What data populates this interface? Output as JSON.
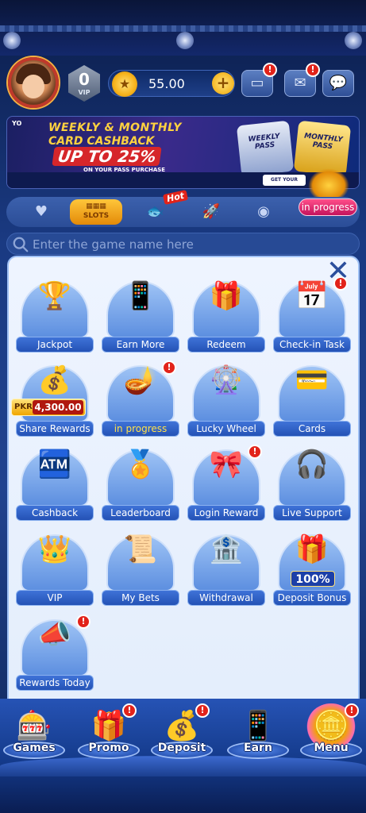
{
  "header": {
    "vip_level": "0",
    "vip_label": "VIP",
    "currency_symbol": "★",
    "balance": "55.00",
    "add_label": "+",
    "wallet_badge": "!",
    "mail_badge": "!"
  },
  "banner": {
    "logo": "YO",
    "line1": "WEEKLY & MONTHLY",
    "line2": "CARD CASHBACK",
    "line3": "UP TO 25%",
    "line4": "ON YOUR PASS PURCHASE",
    "pass1": "WEEKLY PASS",
    "pass2": "MONTHLY PASS",
    "cta": "GET YOUR CLAIM YOUR"
  },
  "categories": {
    "active_label": "SLOTS",
    "hot_label": "Hot",
    "in_progress": "in progress"
  },
  "search": {
    "placeholder": "Enter the game name here"
  },
  "panel": {
    "close_label": "✕",
    "tiles": [
      {
        "label": "Jackpot",
        "icon": "trophy-icon",
        "glyph": "🏆",
        "badge": ""
      },
      {
        "label": "Earn More",
        "icon": "phone-money-icon",
        "glyph": "📱",
        "badge": ""
      },
      {
        "label": "Redeem",
        "icon": "code-bag-icon",
        "glyph": "🎁",
        "badge": ""
      },
      {
        "label": "Check-in Task",
        "icon": "calendar-check-icon",
        "glyph": "📅",
        "badge": "!"
      },
      {
        "label": "Share Rewards",
        "icon": "treasure-chest-icon",
        "glyph": "💰",
        "badge": "",
        "pkr_currency": "PKR",
        "pkr_amount": "4,300.00"
      },
      {
        "label": "in progress",
        "icon": "magic-lamp-icon",
        "glyph": "🪔",
        "badge": "!"
      },
      {
        "label": "Lucky Wheel",
        "icon": "wheel-icon",
        "glyph": "🎡",
        "badge": ""
      },
      {
        "label": "Cards",
        "icon": "card-icon",
        "glyph": "💳",
        "badge": ""
      },
      {
        "label": "Cashback",
        "icon": "cashback-machine-icon",
        "glyph": "🏧",
        "badge": ""
      },
      {
        "label": "Leaderboard",
        "icon": "podium-icon",
        "glyph": "🏅",
        "badge": ""
      },
      {
        "label": "Login Reward",
        "icon": "gift-check-icon",
        "glyph": "🎀",
        "badge": "!"
      },
      {
        "label": "Live Support",
        "icon": "support-agent-icon",
        "glyph": "🎧",
        "badge": ""
      },
      {
        "label": "VIP",
        "icon": "crown-throne-icon",
        "glyph": "👑",
        "badge": ""
      },
      {
        "label": "My Bets",
        "icon": "betting-slips-icon",
        "glyph": "📜",
        "badge": ""
      },
      {
        "label": "Withdrawal",
        "icon": "atm-icon",
        "glyph": "🏦",
        "badge": ""
      },
      {
        "label": "Deposit Bonus",
        "icon": "gift-box-icon",
        "glyph": "🎁",
        "badge": "",
        "bonus_text": "100%"
      },
      {
        "label": "Rewards Today",
        "icon": "megaphone-gift-icon",
        "glyph": "📣",
        "badge": "!"
      }
    ]
  },
  "bottom_nav": [
    {
      "label": "Games",
      "icon": "games-icon",
      "glyph": "🎰",
      "badge": ""
    },
    {
      "label": "Promo",
      "icon": "promo-gift-icon",
      "glyph": "🎁",
      "badge": "!"
    },
    {
      "label": "Deposit",
      "icon": "deposit-chest-icon",
      "glyph": "💰",
      "badge": "!"
    },
    {
      "label": "Earn",
      "icon": "earn-phone-icon",
      "glyph": "📱",
      "badge": ""
    },
    {
      "label": "Menu",
      "icon": "menu-icon",
      "glyph": "🪙",
      "badge": "!"
    }
  ],
  "colors": {
    "accent": "#2452b5",
    "gold": "#f0a500",
    "badge_red": "#e2231a",
    "panel_bg": "#eef4ff"
  }
}
